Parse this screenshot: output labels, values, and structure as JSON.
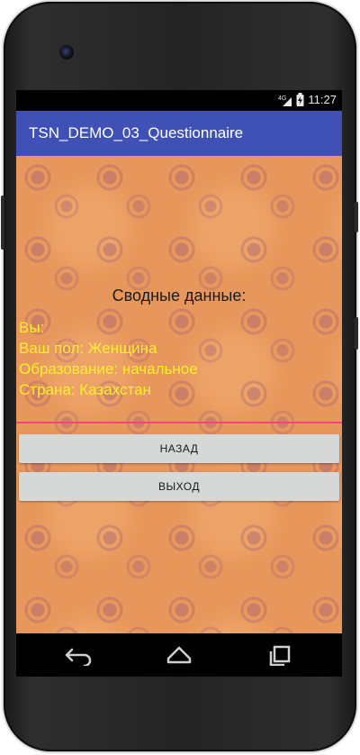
{
  "status_bar": {
    "network": "4G",
    "time": "11:27"
  },
  "app_bar": {
    "title": "TSN_DEMO_03_Questionnaire"
  },
  "summary": {
    "title": "Сводные данные:",
    "lines": [
      "Вы:",
      "Ваш пол: Женщина",
      "Образование: начальное",
      "Страна: Казахстан"
    ]
  },
  "buttons": {
    "back_label": "НАЗАД",
    "exit_label": "ВЫХОД"
  },
  "colors": {
    "app_bar": "#3F51B5",
    "background": "#e7975b",
    "summary_text": "#ffef2a",
    "divider": "#ff4081",
    "button": "#d6d7d7"
  },
  "icons": {
    "status": [
      "network-4g-icon",
      "signal-icon",
      "battery-charging-icon"
    ],
    "nav": [
      "back-icon",
      "home-icon",
      "recents-icon"
    ]
  }
}
